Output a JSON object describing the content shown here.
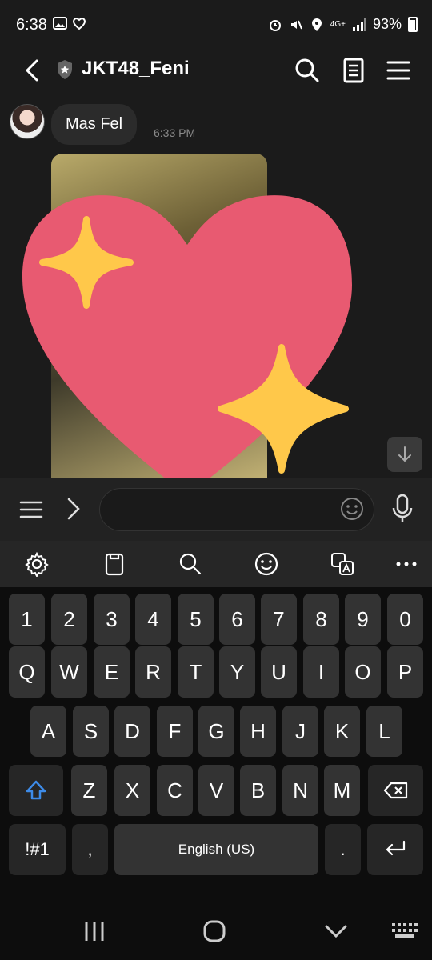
{
  "status_bar": {
    "time": "6:38",
    "network": "4G+",
    "battery": "93%"
  },
  "header": {
    "title": "JKT48_Feni"
  },
  "chat": {
    "messages": [
      {
        "text": "Mas Fel",
        "time": "6:33 PM"
      }
    ]
  },
  "keyboard": {
    "number_row": [
      "1",
      "2",
      "3",
      "4",
      "5",
      "6",
      "7",
      "8",
      "9",
      "0"
    ],
    "row1": [
      "Q",
      "W",
      "E",
      "R",
      "T",
      "Y",
      "U",
      "I",
      "O",
      "P"
    ],
    "row2": [
      "A",
      "S",
      "D",
      "F",
      "G",
      "H",
      "J",
      "K",
      "L"
    ],
    "row3": [
      "Z",
      "X",
      "C",
      "V",
      "B",
      "N",
      "M"
    ],
    "symbols_label": "!#1",
    "comma": ",",
    "space_label": "English (US)",
    "period": "."
  },
  "colors": {
    "background": "#1b1b1b",
    "key": "#333333",
    "shift_accent": "#3d8be8",
    "heart": "#e85a71",
    "sparkle": "#ffc84a"
  }
}
